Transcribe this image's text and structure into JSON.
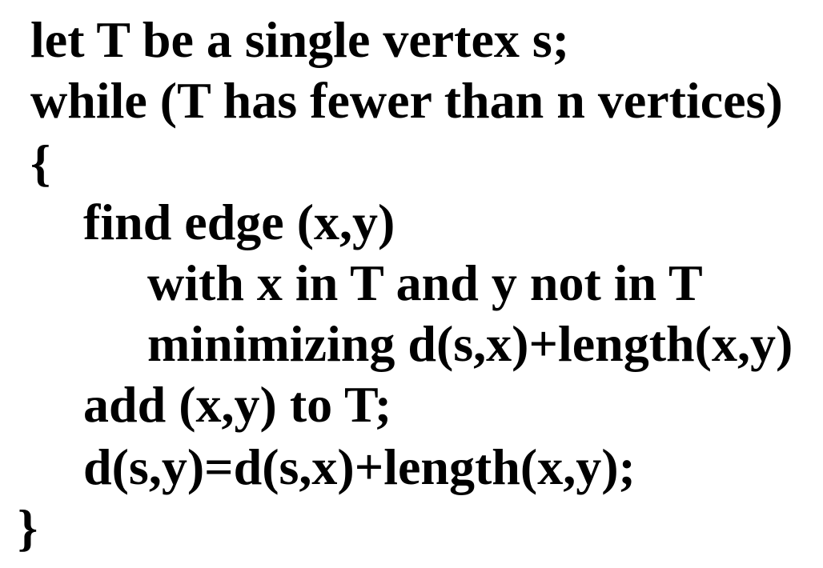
{
  "code": {
    "lines": [
      "let T be a single vertex s;",
      "while (T has fewer than n vertices)",
      "{",
      "find edge (x,y)",
      "with x in T and y not in T",
      "minimizing d(s,x)+length(x,y)",
      "add (x,y) to T;",
      "d(s,y)=d(s,x)+length(x,y);",
      "}"
    ]
  }
}
